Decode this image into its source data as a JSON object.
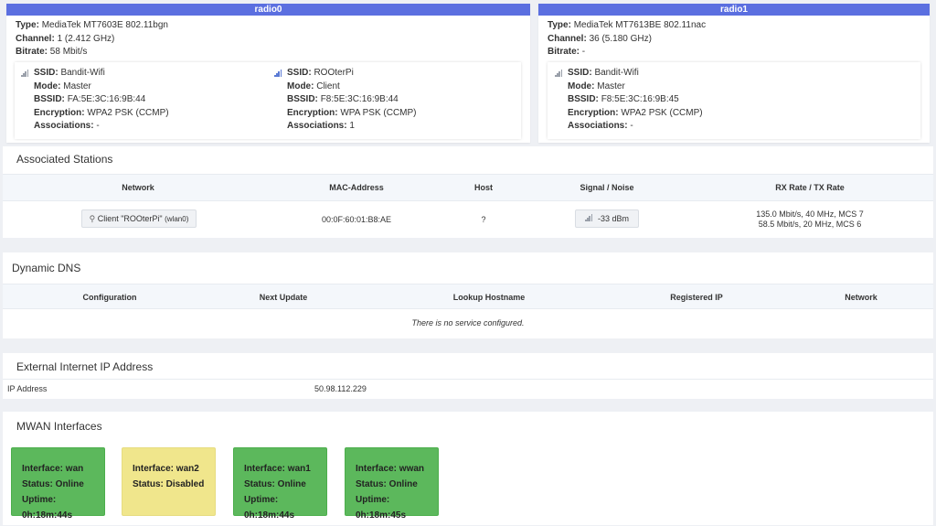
{
  "radios": [
    {
      "name": "radio0",
      "type": "MediaTek MT7603E 802.11bgn",
      "channel": "1 (2.412 GHz)",
      "bitrate": "58 Mbit/s",
      "ssids": [
        {
          "ssid": "Bandit-Wifi",
          "mode": "Master",
          "bssid": "FA:5E:3C:16:9B:44",
          "encryption": "WPA2 PSK (CCMP)",
          "associations": "-"
        },
        {
          "ssid": "ROOterPi",
          "mode": "Client",
          "bssid": "F8:5E:3C:16:9B:44",
          "encryption": "WPA PSK (CCMP)",
          "associations": "1"
        }
      ]
    },
    {
      "name": "radio1",
      "type": "MediaTek MT7613BE 802.11nac",
      "channel": "36 (5.180 GHz)",
      "bitrate": "-",
      "ssids": [
        {
          "ssid": "Bandit-Wifi",
          "mode": "Master",
          "bssid": "F8:5E:3C:16:9B:45",
          "encryption": "WPA2 PSK (CCMP)",
          "associations": "-"
        }
      ]
    }
  ],
  "labels": {
    "type": "Type:",
    "channel": "Channel:",
    "bitrate": "Bitrate:",
    "ssid": "SSID:",
    "mode": "Mode:",
    "bssid": "BSSID:",
    "encryption": "Encryption:",
    "associations": "Associations:"
  },
  "stations": {
    "title": "Associated Stations",
    "columns": [
      "Network",
      "MAC-Address",
      "Host",
      "Signal / Noise",
      "RX Rate / TX Rate"
    ],
    "rows": [
      {
        "network": "Client \"ROOterPi\"",
        "network_iface": "(wlan0)",
        "mac": "00:0F:60:01:B8:AE",
        "host": "?",
        "signal": "-33 dBm",
        "rx": "135.0 Mbit/s, 40 MHz, MCS 7",
        "tx": "58.5 Mbit/s, 20 MHz, MCS 6"
      }
    ]
  },
  "ddns": {
    "title": "Dynamic DNS",
    "columns": [
      "Configuration",
      "Next Update",
      "Lookup Hostname",
      "Registered IP",
      "Network"
    ],
    "empty": "There is no service configured."
  },
  "external_ip": {
    "title": "External Internet IP Address",
    "label": "IP Address",
    "value": "50.98.112.229"
  },
  "mwan": {
    "title": "MWAN Interfaces",
    "interfaces": [
      {
        "line1": "Interface: wan",
        "line2": "Status: Online",
        "line3": "Uptime: 0h:18m:44s",
        "color": "#5cb85c"
      },
      {
        "line1": "Interface: wan2",
        "line2": "Status: Disabled",
        "line3": "",
        "color": "#f0e68c"
      },
      {
        "line1": "Interface: wan1",
        "line2": "Status: Online",
        "line3": "Uptime: 0h:18m:44s",
        "color": "#5cb85c"
      },
      {
        "line1": "Interface: wwan",
        "line2": "Status: Online",
        "line3": "Uptime: 0h:18m:45s",
        "color": "#5cb85c"
      }
    ]
  }
}
